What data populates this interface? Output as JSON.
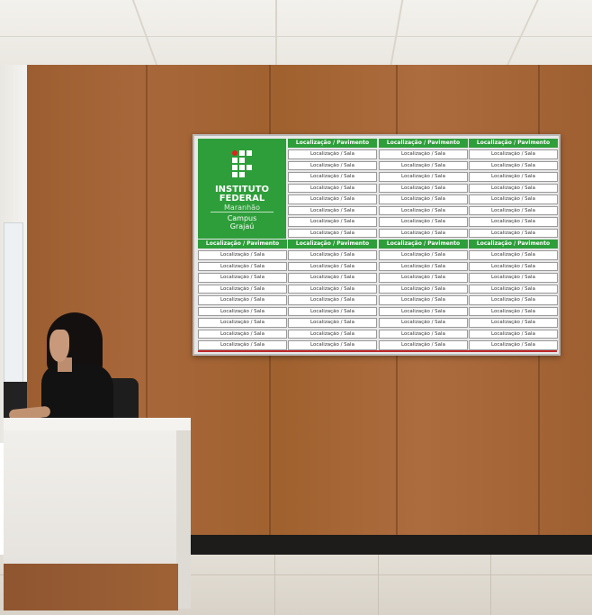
{
  "board": {
    "logo": {
      "line1": "INSTITUTO",
      "line2": "FEDERAL",
      "line3": "Maranhão",
      "line4": "Campus",
      "line5": "Grajaú"
    },
    "header_label": "Localização / Pavimento",
    "cell_label": "Localização / Sala",
    "top_columns": 3,
    "top_rows": 8,
    "bottom_columns": 4,
    "bottom_rows": 9,
    "colors": {
      "brand_green": "#2e9e3a",
      "accent_red": "#c0282a",
      "wood": "#a0612f"
    }
  }
}
